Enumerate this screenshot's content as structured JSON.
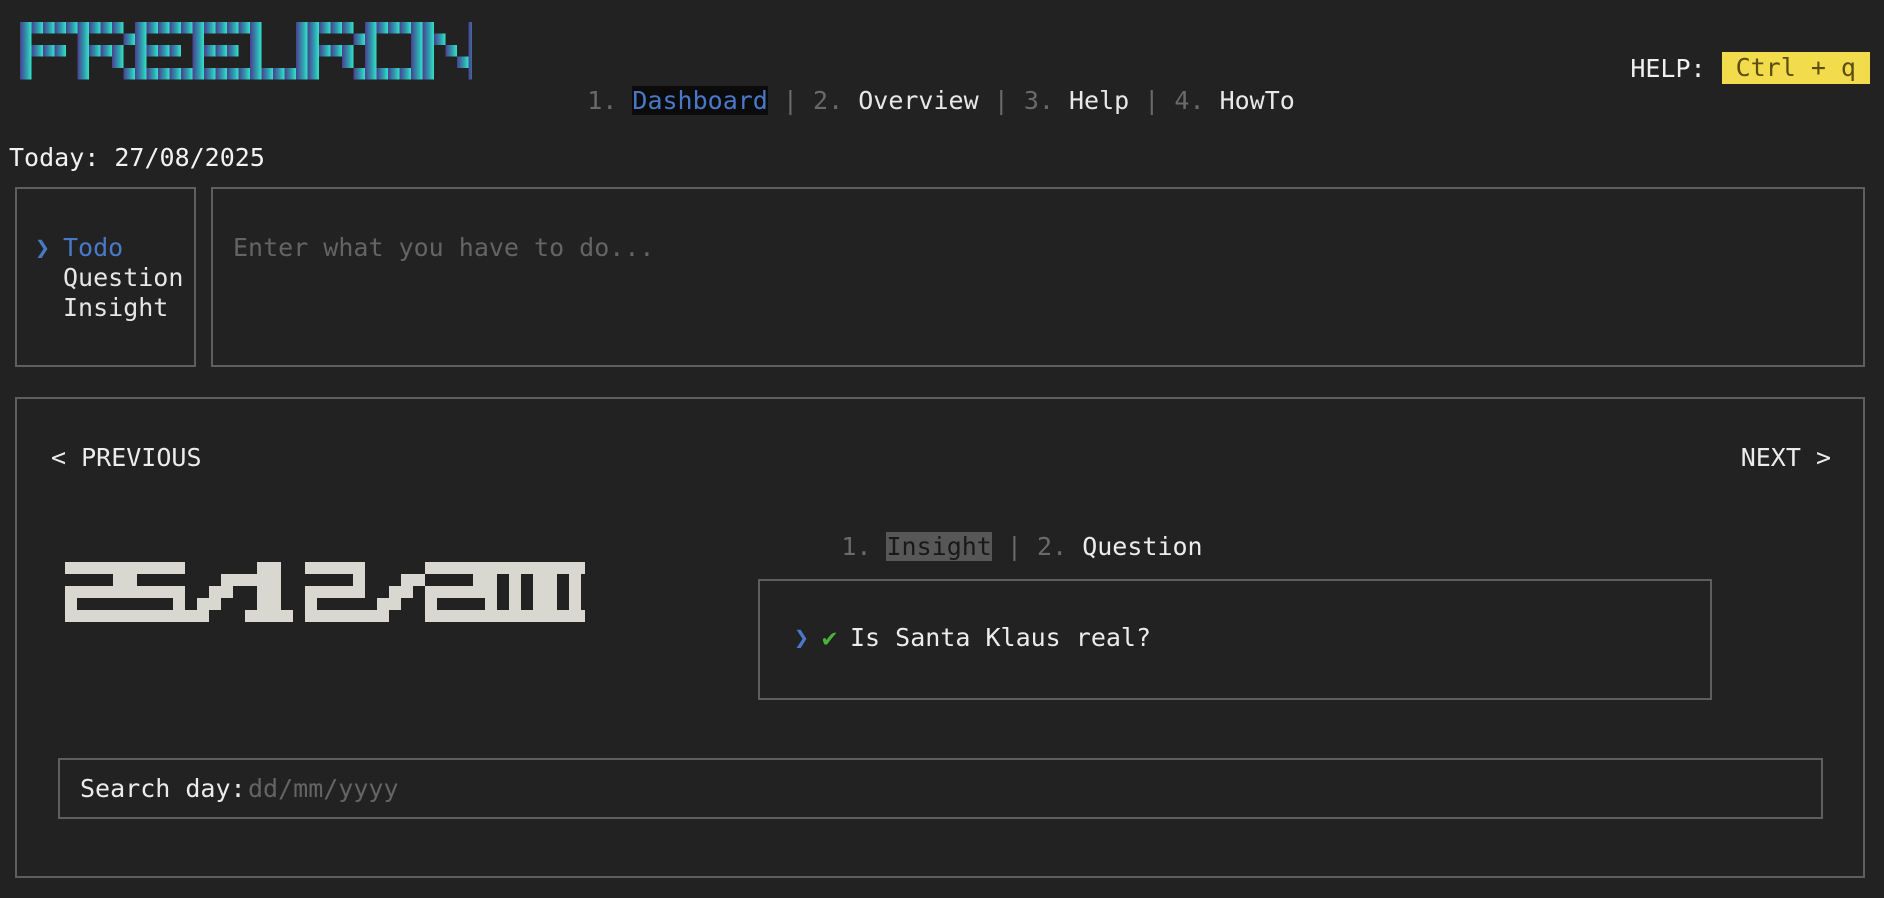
{
  "app": {
    "logo_text": "FREEURON"
  },
  "nav": {
    "items": [
      {
        "num": "1.",
        "label": "Dashboard",
        "active": true
      },
      {
        "num": "2.",
        "label": "Overview",
        "active": false
      },
      {
        "num": "3.",
        "label": "Help",
        "active": false
      },
      {
        "num": "4.",
        "label": "HowTo",
        "active": false
      }
    ],
    "separator": "|"
  },
  "help": {
    "label": "HELP:",
    "shortcut": "Ctrl + q"
  },
  "today": {
    "text": "Today: 27/08/2025"
  },
  "entry_types": {
    "marker": "❯",
    "items": [
      {
        "label": "Todo",
        "active": true
      },
      {
        "label": "Question",
        "active": false
      },
      {
        "label": "Insight",
        "active": false
      }
    ]
  },
  "entry": {
    "placeholder": "Enter what you have to do..."
  },
  "day_panel": {
    "previous_label": "< PREVIOUS",
    "next_label": "NEXT >",
    "big_date": "25/12/2000",
    "tabs": [
      {
        "num": "1.",
        "label": "Insight",
        "active": true
      },
      {
        "num": "2.",
        "label": "Question",
        "active": false
      }
    ],
    "entries": [
      {
        "marker": "❯",
        "check": "✔",
        "text": "Is Santa Klaus real?"
      }
    ],
    "search": {
      "label": "Search day:",
      "placeholder": "dd/mm/yyyy"
    }
  },
  "colors": {
    "background": "#222222",
    "accent_blue": "#4a78c8",
    "check_green": "#4ab23a",
    "help_badge": "#f2dc4c",
    "border": "#5e5e5e",
    "logo_gradient": [
      "#4a3f8f",
      "#2f9fb0",
      "#35e3c8"
    ]
  }
}
